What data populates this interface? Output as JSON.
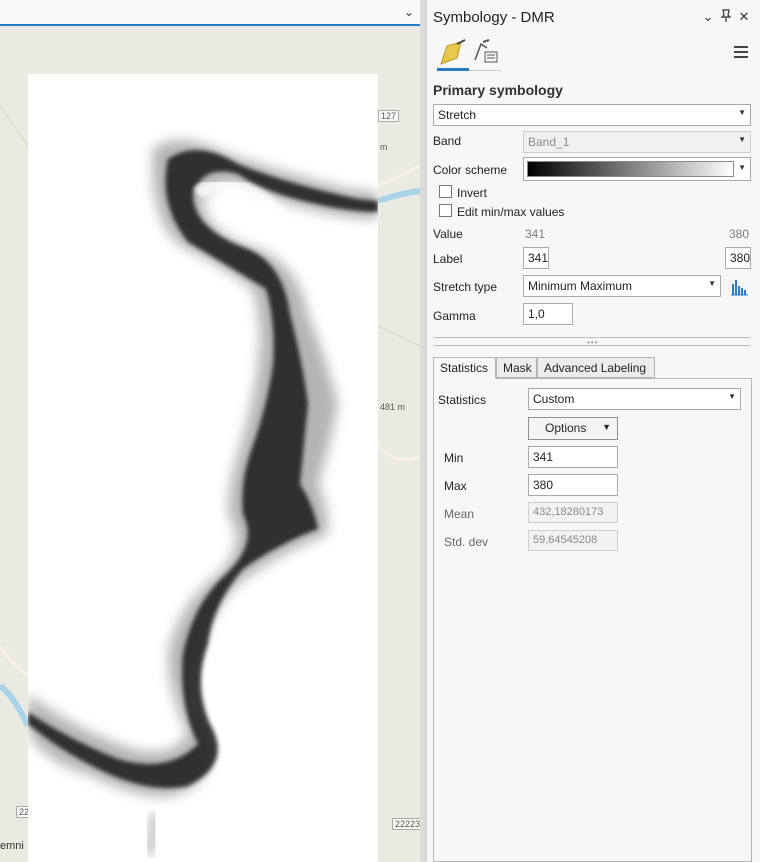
{
  "map": {
    "labels": [
      "127",
      "m",
      "481 m",
      "22",
      "22223",
      "emni"
    ],
    "topbar_chevron": "⌄"
  },
  "pane": {
    "title": "Symbology - DMR",
    "controls": {
      "dropdown": "⌄",
      "pin": "📌",
      "close": "✕"
    },
    "tools": [
      "primary-symbology-icon",
      "vary-symbology-icon"
    ],
    "section_title": "Primary symbology",
    "renderer": "Stretch",
    "band_label": "Band",
    "band_value": "Band_1",
    "color_scheme_label": "Color scheme",
    "invert_label": "Invert",
    "edit_minmax_label": "Edit min/max values",
    "value_label": "Value",
    "value_min": "341",
    "value_max": "380",
    "label_label": "Label",
    "label_min": "341",
    "label_max": "380",
    "stretch_type_label": "Stretch type",
    "stretch_type": "Minimum Maximum",
    "gamma_label": "Gamma",
    "gamma_value": "1,0",
    "tabs": [
      "Statistics",
      "Mask",
      "Advanced Labeling"
    ],
    "statistics_label": "Statistics",
    "statistics_value": "Custom",
    "options_label": "Options",
    "min_label": "Min",
    "min_value": "341",
    "max_label": "Max",
    "max_value": "380",
    "mean_label": "Mean",
    "mean_value": "432,18280173",
    "stddev_label": "Std. dev",
    "stddev_value": "59,64545208"
  },
  "colors": {
    "accent": "#2b78c5",
    "pencil": "#e8c84a"
  }
}
